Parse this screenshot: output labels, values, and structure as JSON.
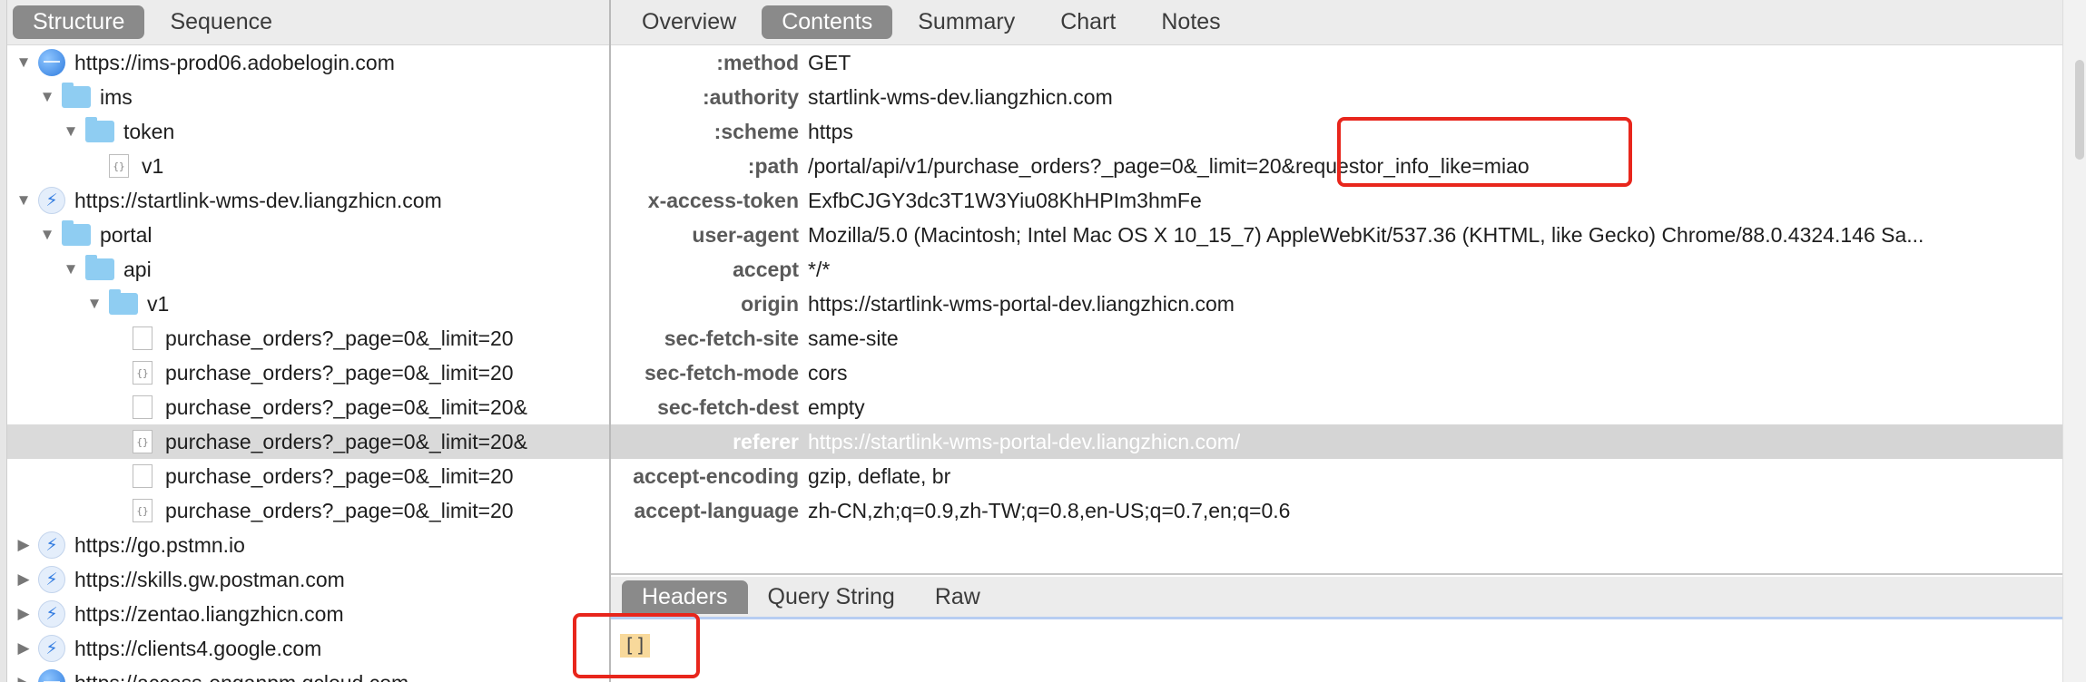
{
  "left": {
    "tabs": [
      {
        "label": "Structure",
        "active": true
      },
      {
        "label": "Sequence",
        "active": false
      }
    ],
    "tree": [
      {
        "level": 0,
        "expanded": true,
        "icon": "globe-icon",
        "label": "https://ims-prod06.adobelogin.com"
      },
      {
        "level": 1,
        "expanded": true,
        "icon": "folder-icon",
        "label": "ims"
      },
      {
        "level": 2,
        "expanded": true,
        "icon": "folder-icon",
        "label": "token"
      },
      {
        "level": 3,
        "expanded": null,
        "icon": "json-file-icon",
        "label": "v1"
      },
      {
        "level": 0,
        "expanded": true,
        "icon": "bolt-icon",
        "label": "https://startlink-wms-dev.liangzhicn.com"
      },
      {
        "level": 1,
        "expanded": true,
        "icon": "folder-icon",
        "label": "portal"
      },
      {
        "level": 2,
        "expanded": true,
        "icon": "folder-icon",
        "label": "api"
      },
      {
        "level": 3,
        "expanded": true,
        "icon": "folder-icon",
        "label": "v1"
      },
      {
        "level": 4,
        "expanded": null,
        "icon": "file-icon",
        "label": "purchase_orders?_page=0&_limit=20"
      },
      {
        "level": 4,
        "expanded": null,
        "icon": "json-file-icon",
        "label": "purchase_orders?_page=0&_limit=20"
      },
      {
        "level": 4,
        "expanded": null,
        "icon": "file-icon",
        "label": "purchase_orders?_page=0&_limit=20&"
      },
      {
        "level": 4,
        "expanded": null,
        "icon": "json-file-icon",
        "label": "purchase_orders?_page=0&_limit=20&",
        "selected": true
      },
      {
        "level": 4,
        "expanded": null,
        "icon": "file-icon",
        "label": "purchase_orders?_page=0&_limit=20"
      },
      {
        "level": 4,
        "expanded": null,
        "icon": "json-file-icon",
        "label": "purchase_orders?_page=0&_limit=20"
      },
      {
        "level": 0,
        "expanded": false,
        "icon": "bolt-icon",
        "label": "https://go.pstmn.io"
      },
      {
        "level": 0,
        "expanded": false,
        "icon": "bolt-icon",
        "label": "https://skills.gw.postman.com"
      },
      {
        "level": 0,
        "expanded": false,
        "icon": "bolt-icon",
        "label": "https://zentao.liangzhicn.com"
      },
      {
        "level": 0,
        "expanded": false,
        "icon": "bolt-icon",
        "label": "https://clients4.google.com"
      },
      {
        "level": 0,
        "expanded": false,
        "icon": "globe-icon",
        "label": "https://access-enganpm.qcloud.com"
      }
    ]
  },
  "right": {
    "tabs": [
      {
        "label": "Overview",
        "active": false
      },
      {
        "label": "Contents",
        "active": true
      },
      {
        "label": "Summary",
        "active": false
      },
      {
        "label": "Chart",
        "active": false
      },
      {
        "label": "Notes",
        "active": false
      }
    ],
    "headers": [
      {
        "key": ":method",
        "value": "GET"
      },
      {
        "key": ":authority",
        "value": "startlink-wms-dev.liangzhicn.com"
      },
      {
        "key": ":scheme",
        "value": "https"
      },
      {
        "key": ":path",
        "value": "/portal/api/v1/purchase_orders?_page=0&_limit=20&requestor_info_like=miao"
      },
      {
        "key": "x-access-token",
        "value": "ExfbCJGY3dc3T1W3Yiu08KhHPIm3hmFe"
      },
      {
        "key": "user-agent",
        "value": "Mozilla/5.0 (Macintosh; Intel Mac OS X 10_15_7) AppleWebKit/537.36 (KHTML, like Gecko) Chrome/88.0.4324.146 Sa..."
      },
      {
        "key": "accept",
        "value": "*/*"
      },
      {
        "key": "origin",
        "value": "https://startlink-wms-portal-dev.liangzhicn.com"
      },
      {
        "key": "sec-fetch-site",
        "value": "same-site"
      },
      {
        "key": "sec-fetch-mode",
        "value": "cors"
      },
      {
        "key": "sec-fetch-dest",
        "value": "empty"
      },
      {
        "key": "referer",
        "value": "https://startlink-wms-portal-dev.liangzhicn.com/",
        "selected": true
      },
      {
        "key": "accept-encoding",
        "value": "gzip, deflate, br"
      },
      {
        "key": "accept-language",
        "value": "zh-CN,zh;q=0.9,zh-TW;q=0.8,en-US;q=0.7,en;q=0.6"
      }
    ],
    "bottom_tabs": [
      {
        "label": "Headers",
        "active": true
      },
      {
        "label": "Query String",
        "active": false
      },
      {
        "label": "Raw",
        "active": false
      }
    ],
    "body_content": "[]"
  },
  "colors": {
    "annotation": "#e8261c",
    "active_tab": "#8a8a8a",
    "selection": "#d5d5d5"
  }
}
